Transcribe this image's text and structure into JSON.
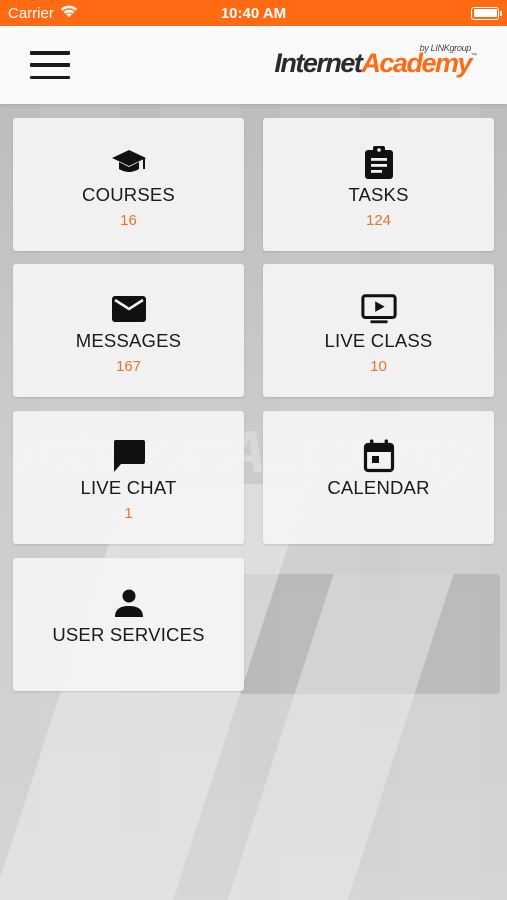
{
  "status_bar": {
    "carrier": "Carrier",
    "time": "10:40 AM"
  },
  "header": {
    "logo_part1": "Internet",
    "logo_part2": "Academy",
    "logo_by": "by LINKgroup",
    "logo_tm": "™"
  },
  "background": {
    "watermark": "InternetAcademy"
  },
  "tiles": [
    {
      "label": "COURSES",
      "count": "16",
      "icon": "graduation-cap-icon"
    },
    {
      "label": "TASKS",
      "count": "124",
      "icon": "clipboard-icon"
    },
    {
      "label": "MESSAGES",
      "count": "167",
      "icon": "envelope-icon"
    },
    {
      "label": "LIVE CLASS",
      "count": "10",
      "icon": "video-screen-icon"
    },
    {
      "label": "LIVE CHAT",
      "count": "1",
      "icon": "chat-bubble-icon"
    },
    {
      "label": "CALENDAR",
      "count": "",
      "icon": "calendar-icon"
    },
    {
      "label": "USER SERVICES",
      "count": "",
      "icon": "user-icon"
    }
  ],
  "colors": {
    "accent": "#ff6a13",
    "count": "#e8742a"
  }
}
